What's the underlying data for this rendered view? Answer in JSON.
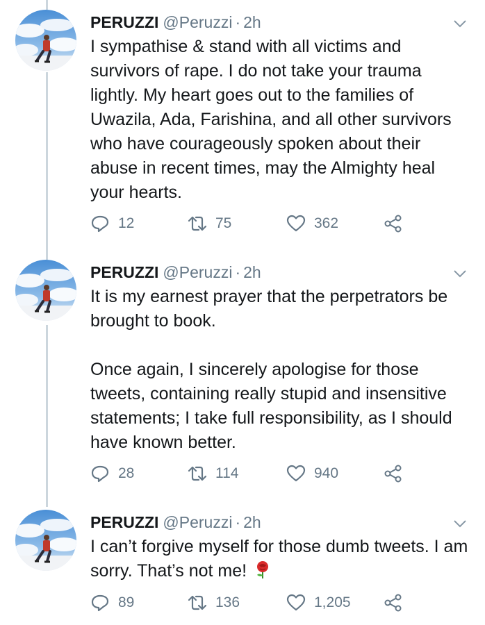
{
  "tweets": [
    {
      "name": "PERUZZI",
      "handle": "@Peruzzi",
      "separator": "·",
      "time": "2h",
      "paragraphs": [
        "I sympathise & stand with all victims and survivors of rape. I do not take your trauma lightly. My heart goes out to the families of Uwazila, Ada, Farishina, and all other survivors who have courageously spoken about their abuse in recent times, may the Almighty heal your hearts."
      ],
      "replies": "12",
      "retweets": "75",
      "likes": "362"
    },
    {
      "name": "PERUZZI",
      "handle": "@Peruzzi",
      "separator": "·",
      "time": "2h",
      "paragraphs": [
        "It is my earnest prayer that the perpetrators be brought to book.",
        "Once again, I sincerely apologise for those tweets, containing really stupid and insensitive statements; I take full responsibility, as I should have known better."
      ],
      "replies": "28",
      "retweets": "114",
      "likes": "940"
    },
    {
      "name": "PERUZZI",
      "handle": "@Peruzzi",
      "separator": "·",
      "time": "2h",
      "paragraphs": [
        "I can’t forgive myself for those dumb tweets. I am sorry. That’s not me!"
      ],
      "emoji": "rose-emoji",
      "replies": "89",
      "retweets": "136",
      "likes": "1,205"
    }
  ],
  "icons": {
    "reply": "reply-icon",
    "retweet": "retweet-icon",
    "like": "heart-icon",
    "share": "share-icon",
    "menu": "chevron-down-icon"
  },
  "colors": {
    "text": "#14171a",
    "secondary": "#657786",
    "thread_line": "#ccd6dd",
    "background": "#ffffff"
  }
}
